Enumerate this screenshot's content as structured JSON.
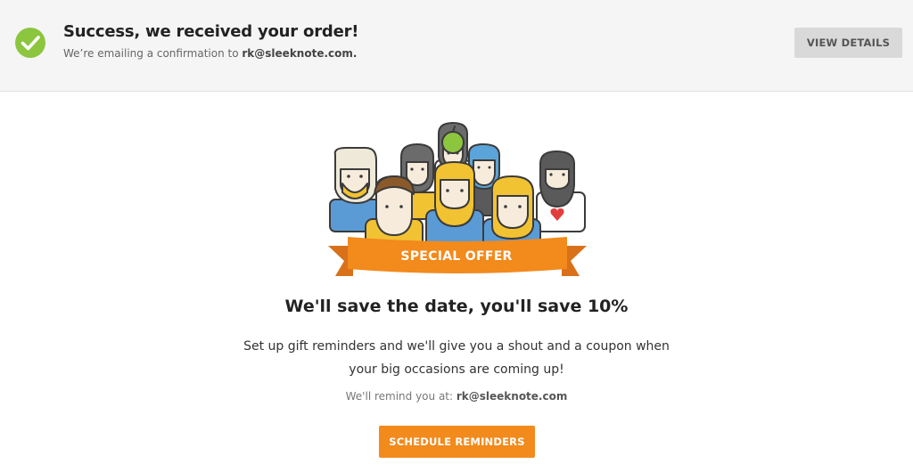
{
  "banner": {
    "title": "Success, we received your order!",
    "subtitle_prefix": "We’re emailing a confirmation to ",
    "email": "rk@sleeknote.com.",
    "button_label": "VIEW DETAILS",
    "icon": "checkmark-circle-icon",
    "icon_color": "#8cc63f"
  },
  "offer": {
    "ribbon_label": "SPECIAL OFFER",
    "ribbon_color": "#f28a1c",
    "headline": "We'll save the date, you'll save 10%",
    "description": "Set up gift reminders and we'll give you a shout and a coupon when your big occasions are coming up!",
    "remind_prefix": "We'll remind you at: ",
    "remind_email": "rk@sleeknote.com",
    "button_label": "SCHEDULE REMINDERS",
    "button_color": "#f28a1c"
  }
}
